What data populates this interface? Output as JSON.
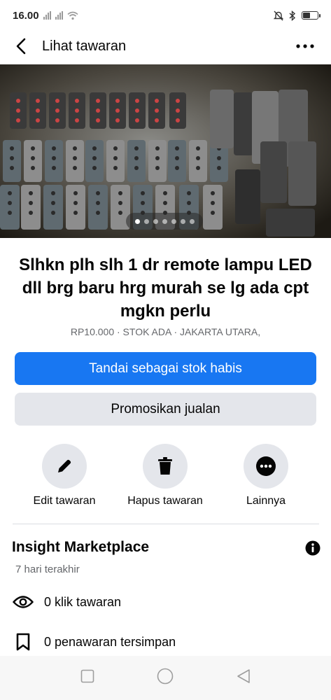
{
  "status_bar": {
    "time": "16.00",
    "battery_level": 0.55
  },
  "header": {
    "title": "Lihat tawaran",
    "back_icon": "chevron-left-icon",
    "more_icon": "more-horizontal-icon"
  },
  "photo": {
    "total_photos": 7,
    "current_photo": 1
  },
  "listing": {
    "title": "Slhkn plh slh 1 dr remote lampu LED dll brg baru hrg murah se lg ada cpt mgkn perlu",
    "meta": "RP10.000 · STOK ADA · JAKARTA UTARA,"
  },
  "buttons": {
    "mark_sold": "Tandai sebagai stok habis",
    "promote": "Promosikan jualan"
  },
  "actions": [
    {
      "label": "Edit tawaran",
      "icon": "pencil-icon"
    },
    {
      "label": "Hapus tawaran",
      "icon": "trash-icon"
    },
    {
      "label": "Lainnya",
      "icon": "more-icon"
    }
  ],
  "insight": {
    "title": "Insight Marketplace",
    "period": "7 hari terakhir",
    "stats": [
      {
        "text": "0 klik tawaran",
        "icon": "eye-icon"
      },
      {
        "text": "0 penawaran tersimpan",
        "icon": "bookmark-icon"
      }
    ]
  },
  "colors": {
    "primary": "#1877f2",
    "secondary_bg": "#e4e6eb",
    "muted_text": "#65676b"
  }
}
